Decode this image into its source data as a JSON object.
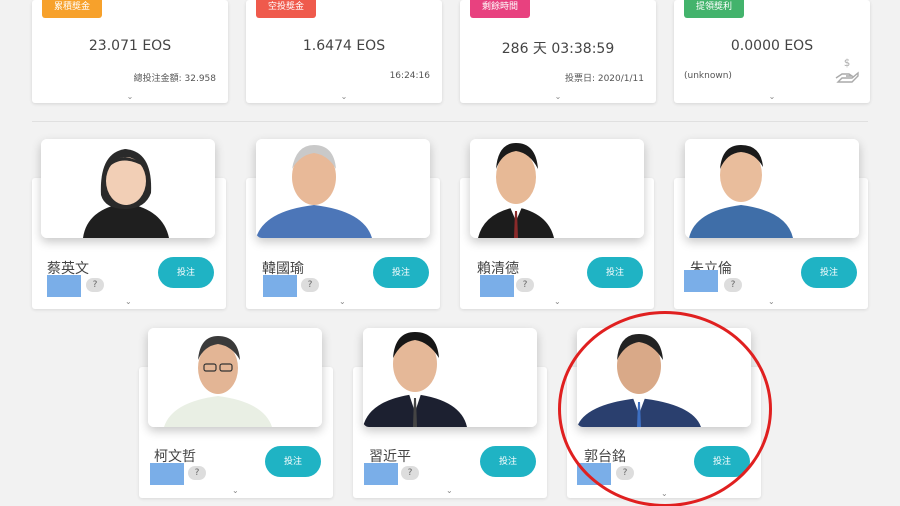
{
  "stats": [
    {
      "badge": "累積獎金",
      "badge_color": "#f7a12b",
      "value": "23.071 EOS",
      "sub": "總投注金額: 32.958",
      "sub_align": "right"
    },
    {
      "badge": "空投獎金",
      "badge_color": "#ef5a4c",
      "value": "1.6474 EOS",
      "sub": "16:24:16",
      "sub_align": "right"
    },
    {
      "badge": "剩餘時間",
      "badge_color": "#e8417f",
      "value": "286 天 03:38:59",
      "sub": "投票日: 2020/1/11",
      "sub_align": "right"
    },
    {
      "badge": "提領獎利",
      "badge_color": "#43b36c",
      "value": "0.0000 EOS",
      "sub": "(unknown)",
      "sub_align": "left",
      "icon": "money-hand-icon"
    }
  ],
  "candidates": [
    {
      "name": "蔡英文",
      "bet_label": "投注",
      "q": "?"
    },
    {
      "name": "韓國瑜",
      "bet_label": "投注",
      "q": "?"
    },
    {
      "name": "賴清德",
      "bet_label": "投注",
      "q": "?"
    },
    {
      "name": "朱立倫",
      "bet_label": "投注",
      "q": "?"
    },
    {
      "name": "柯文哲",
      "bet_label": "投注",
      "q": "?"
    },
    {
      "name": "習近平",
      "bet_label": "投注",
      "q": "?"
    },
    {
      "name": "郭台銘",
      "bet_label": "投注",
      "q": "?"
    }
  ],
  "colors": {
    "accent": "#1fb3c4",
    "highlight": "#e02020",
    "redacted": "#7aaee8"
  }
}
